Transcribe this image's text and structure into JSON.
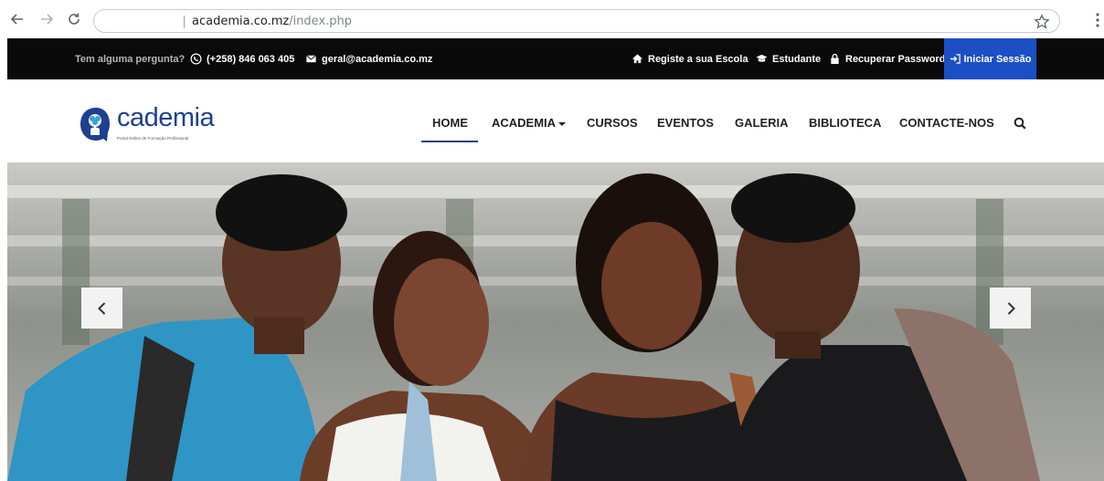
{
  "browser": {
    "url_domain": "academia.co.mz",
    "url_path": "/index.php"
  },
  "topbar": {
    "question": "Tem alguma pergunta?",
    "phone": "(+258) 846 063 405",
    "email": "geral@academia.co.mz",
    "register_school": "Registe a sua Escola",
    "student": "Estudante",
    "recover_password": "Recuperar Password",
    "login": "Iniciar Sessão"
  },
  "logo": {
    "text": "cademia",
    "tagline": "Portal Online de Formação Profissional"
  },
  "nav": {
    "items": [
      {
        "label": "HOME",
        "active": true
      },
      {
        "label": "ACADEMIA",
        "dropdown": true
      },
      {
        "label": "CURSOS"
      },
      {
        "label": "EVENTOS"
      },
      {
        "label": "GALERIA"
      },
      {
        "label": "BIBLIOTECA"
      },
      {
        "label": "CONTACTE-NOS"
      }
    ]
  },
  "hero": {
    "image": "students-smiling-photo",
    "prev_icon": "chevron-left-icon",
    "next_icon": "chevron-right-icon"
  },
  "colors": {
    "topbar_bg": "#0a0a0a",
    "login_bg": "#1d4fc4",
    "brand_blue": "#1f3f8f"
  }
}
